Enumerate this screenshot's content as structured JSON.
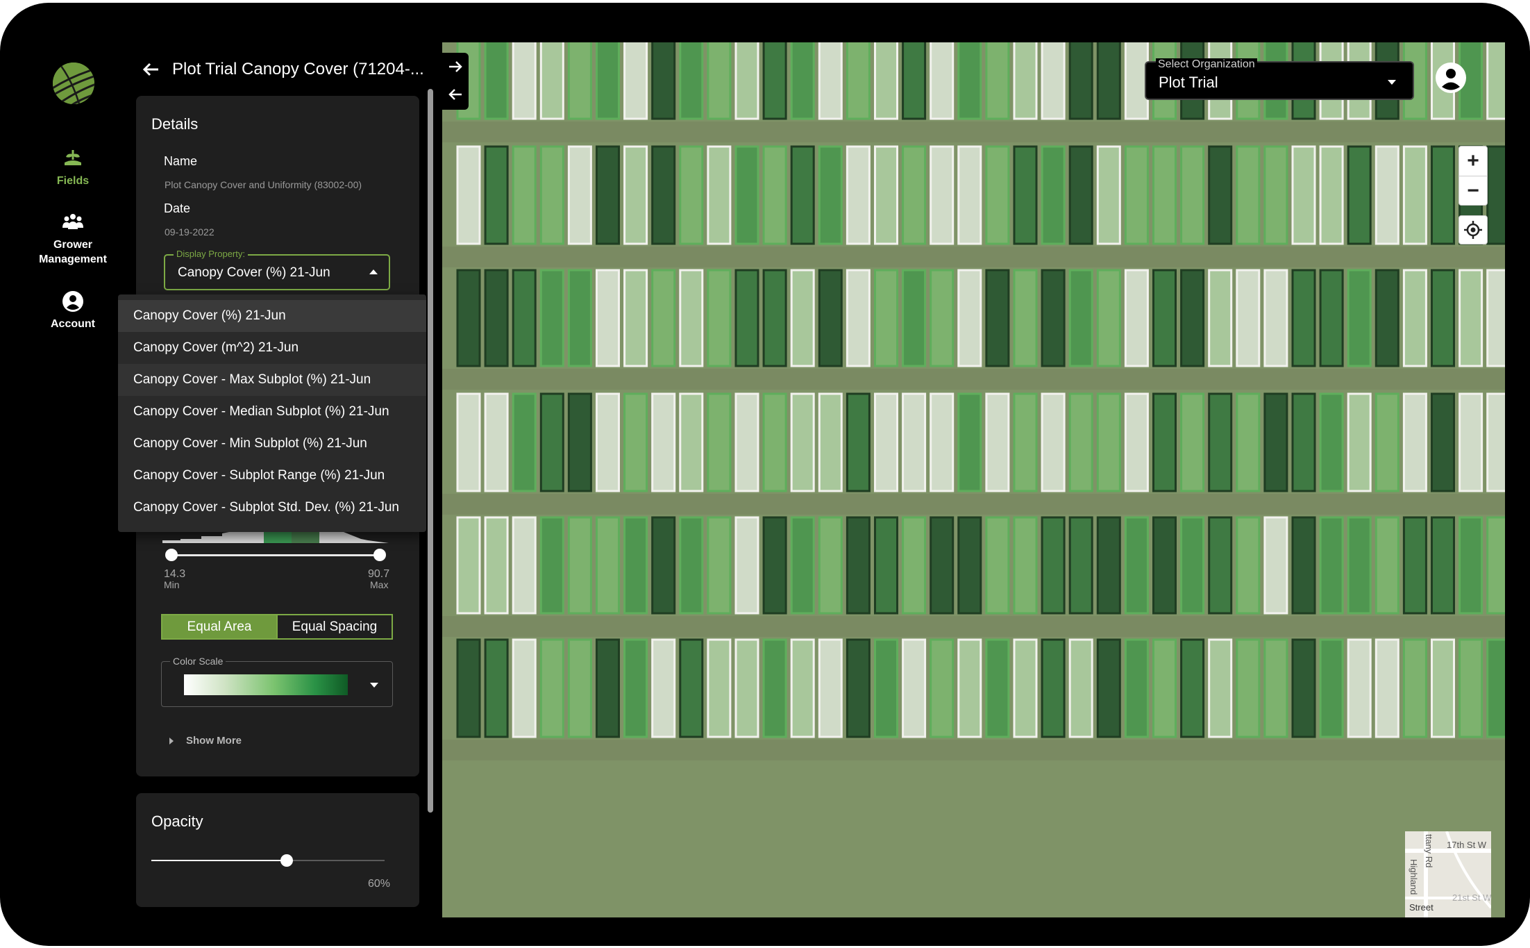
{
  "rail": {
    "items": [
      {
        "label": "Fields",
        "icon": "fields-icon"
      },
      {
        "label": "Grower\nManagement",
        "icon": "grower-management-icon"
      },
      {
        "label": "Account",
        "icon": "account-icon"
      }
    ]
  },
  "panel": {
    "title": "Plot Trial Canopy Cover (71204-...",
    "details": {
      "heading": "Details",
      "name_label": "Name",
      "name_value": "Plot Canopy Cover and Uniformity (83002-00)",
      "date_label": "Date",
      "date_value": "09-19-2022",
      "display_property_label": "Display Property:",
      "display_property_value": "Canopy Cover (%) 21-Jun",
      "menu_options": [
        "Canopy Cover (%) 21-Jun",
        "Canopy Cover (m^2) 21-Jun",
        "Canopy Cover - Max Subplot (%) 21-Jun",
        "Canopy Cover - Median Subplot (%) 21-Jun",
        "Canopy Cover - Min Subplot (%) 21-Jun",
        "Canopy Cover - Subplot Range (%) 21-Jun",
        "Canopy Cover - Subplot Std. Dev. (%) 21-Jun"
      ],
      "range": {
        "min_value": "14.3",
        "min_label": "Min",
        "max_value": "90.7",
        "max_label": "Max"
      },
      "binning": {
        "equal_area": "Equal Area",
        "equal_spacing": "Equal Spacing",
        "selected": "Equal Area"
      },
      "color_scale_label": "Color Scale",
      "show_more": "Show More"
    },
    "opacity": {
      "heading": "Opacity",
      "value_text": "60%",
      "value": 0.6
    }
  },
  "map": {
    "organization_label": "Select Organization",
    "organization_value": "Plot Trial",
    "zoom_in": "+",
    "zoom_out": "−",
    "minimap": {
      "label1": "17th St W",
      "label2": "Highland",
      "label3": "21st St W",
      "label4": "Street",
      "label5": "ttany Rd"
    }
  },
  "colors": {
    "accent": "#7daa45",
    "plot_scale": [
      "#d0dbc8",
      "#a8c79b",
      "#7db26e",
      "#4f9650",
      "#3f7a43",
      "#2f5a34"
    ]
  }
}
